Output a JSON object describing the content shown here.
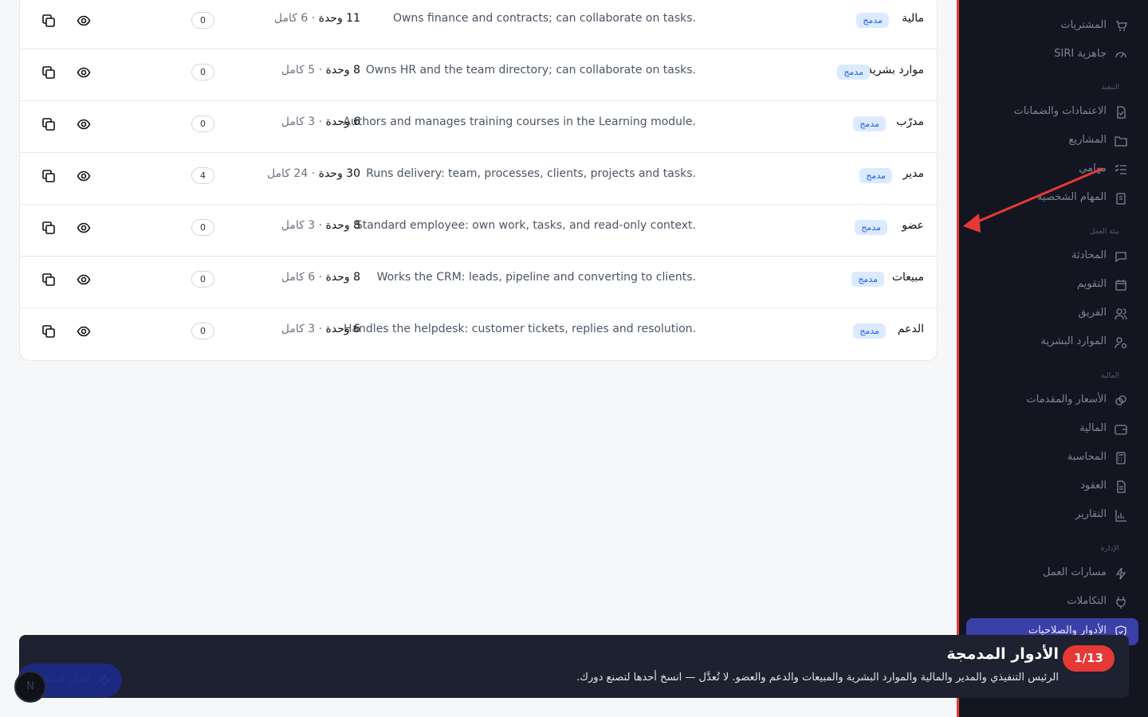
{
  "roles": [
    {
      "name": "مالية",
      "badge": "مدمج",
      "description": ".Owns finance and contracts; can collaborate on tasks",
      "stats_units": "11",
      "stats_units_label": "وحدة",
      "stats_full": "6 كامل",
      "members": "0"
    },
    {
      "name": "موارد بشرية",
      "badge": "مدمج",
      "description": ".Owns HR and the team directory; can collaborate on tasks",
      "stats_units": "8",
      "stats_units_label": "وحدة",
      "stats_full": "5 كامل",
      "members": "0"
    },
    {
      "name": "مدرّب",
      "badge": "مدمج",
      "description": ".Authors and manages training courses in the Learning module",
      "stats_units": "6",
      "stats_units_label": "وحدة",
      "stats_full": "3 كامل",
      "members": "0"
    },
    {
      "name": "مدير",
      "badge": "مدمج",
      "description": ".Runs delivery: team, processes, clients, projects and tasks",
      "stats_units": "30",
      "stats_units_label": "وحدة",
      "stats_full": "24 كامل",
      "members": "4"
    },
    {
      "name": "عضو",
      "badge": "مدمج",
      "description": ".Standard employee: own work, tasks, and read-only context",
      "stats_units": "8",
      "stats_units_label": "وحدة",
      "stats_full": "3 كامل",
      "members": "0"
    },
    {
      "name": "مبيعات",
      "badge": "مدمج",
      "description": ".Works the CRM: leads, pipeline and converting to clients",
      "stats_units": "8",
      "stats_units_label": "وحدة",
      "stats_full": "6 كامل",
      "members": "0"
    },
    {
      "name": "الدعم",
      "badge": "مدمج",
      "description": ".Handles the helpdesk: customer tickets, replies and resolution",
      "stats_units": "6",
      "stats_units_label": "وحدة",
      "stats_full": "3 كامل",
      "members": "0"
    }
  ],
  "sidebar": {
    "items_top": [
      {
        "label": "المشتريات",
        "icon": "cart-icon"
      },
      {
        "label": "جاهزية SIRI",
        "icon": "gauge-icon"
      }
    ],
    "section_execution": "التنفيذ",
    "items_execution": [
      {
        "label": "الاعتمادات والضمانات",
        "icon": "file-check-icon"
      },
      {
        "label": "المشاريع",
        "icon": "folder-icon"
      },
      {
        "label": "مهامي",
        "icon": "list-check-icon"
      },
      {
        "label": "المهام الشخصية",
        "icon": "clipboard-icon"
      }
    ],
    "section_workspace": "بيئة العمل",
    "items_workspace": [
      {
        "label": "المحادثة",
        "icon": "chat-icon"
      },
      {
        "label": "التقويم",
        "icon": "calendar-icon"
      },
      {
        "label": "الفريق",
        "icon": "users-icon"
      },
      {
        "label": "الموارد البشرية",
        "icon": "user-gear-icon"
      }
    ],
    "section_finance": "المالية",
    "items_finance": [
      {
        "label": "الأسعار والمقدمات",
        "icon": "coins-icon"
      },
      {
        "label": "المالية",
        "icon": "wallet-icon"
      },
      {
        "label": "المحاسبة",
        "icon": "calculator-icon"
      },
      {
        "label": "العقود",
        "icon": "document-icon"
      },
      {
        "label": "التقارير",
        "icon": "bar-chart-icon"
      }
    ],
    "section_admin": "الإدارة",
    "items_admin": [
      {
        "label": "مسارات العمل",
        "icon": "bolt-icon"
      },
      {
        "label": "التكاملات",
        "icon": "plug-icon"
      },
      {
        "label": "الأدوار والصلاحيات",
        "icon": "shield-icon",
        "active": true
      }
    ]
  },
  "tour": {
    "step": "1/13",
    "title": "الأدوار المدمجة",
    "text": "الرئيس التنفيذي والمدير والمالية والموارد البشرية والمبيعات والدعم والعضو. لا تُعدَّل — انسخ أحدها لتصنع دورك."
  },
  "fab": {
    "label": "اسأل الذكاء",
    "icon": "sparkle-icon"
  },
  "avatar": {
    "initial": "N"
  },
  "colors": {
    "accent": "#3b3fa8",
    "tour_step": "#e53935",
    "badge_bg": "#dbeafe",
    "badge_text": "#2563eb",
    "sidebar_bg": "#131621",
    "arrow": "#e53935"
  }
}
